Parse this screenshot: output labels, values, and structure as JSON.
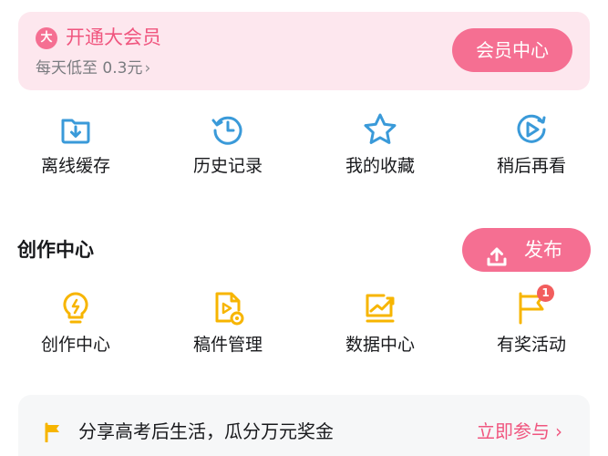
{
  "vip": {
    "badge": "大",
    "title": "开通大会员",
    "subtitle": "每天低至 0.3元",
    "chevron": "›",
    "button_label": "会员中心",
    "accent": "#f56f92",
    "background": "#fde7ee"
  },
  "quick_actions": [
    {
      "label": "离线缓存",
      "icon": "download-folder-icon"
    },
    {
      "label": "历史记录",
      "icon": "history-clock-icon"
    },
    {
      "label": "我的收藏",
      "icon": "star-icon"
    },
    {
      "label": "稍后再看",
      "icon": "play-later-icon"
    }
  ],
  "creation": {
    "section_title": "创作中心",
    "publish_label": "发布",
    "items": [
      {
        "label": "创作中心",
        "icon": "lightbulb-icon"
      },
      {
        "label": "稿件管理",
        "icon": "manuscript-icon"
      },
      {
        "label": "数据中心",
        "icon": "data-chart-icon"
      },
      {
        "label": "有奖活动",
        "icon": "prize-flag-icon",
        "badge": "1"
      }
    ]
  },
  "activity": {
    "text": "分享高考后生活，瓜分万元奖金",
    "link_label": "立即参与",
    "chevron": "›"
  },
  "colors": {
    "blue_icon": "#3a9ad9",
    "yellow_icon": "#f7b500",
    "pink": "#f56f92",
    "badge_red": "#f25d5d"
  }
}
